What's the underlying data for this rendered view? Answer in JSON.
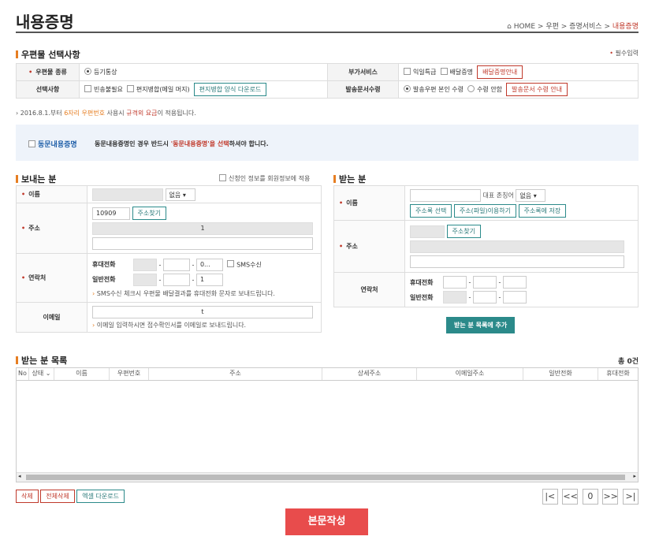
{
  "header": {
    "title": "내용증명",
    "breadcrumb": {
      "home": "HOME",
      "sep": ">",
      "c1": "우편",
      "c2": "증명서비스",
      "c3": "내용증명"
    }
  },
  "mail": {
    "section": "우편물 선택사항",
    "required": "필수입력",
    "type_label": "우편물 종류",
    "type_value": "등기통상",
    "extra_label": "부가서비스",
    "extra_opt1": "익일특급",
    "extra_opt2": "배달증명",
    "extra_btn": "배달증명안내",
    "select_label": "선택사항",
    "sel_opt1": "빈송불필요",
    "sel_opt2": "편지병합(메일 머지)",
    "sel_btn": "편지병합 양식 다운로드",
    "recv_label": "발송문서수령",
    "recv_opt1": "발송우편 본인 수령",
    "recv_opt2": "수령 안함",
    "recv_btn": "발송문서 수령 안내"
  },
  "notice": {
    "prefix": "› 2016.8.1.부터 ",
    "a": "6자리 우편번호",
    "b": " 사용시 ",
    "c": "규격외 요금",
    "d": "이 적용됩니다."
  },
  "same": {
    "label": "동문내용증명",
    "t1": "동문내용증명인 경우 반드시 ",
    "t2": "'동문내용증명'을 선택",
    "t3": "하셔야 합니다."
  },
  "sender": {
    "section": "보내는 분",
    "apply": "신청인 정보를 회원정보에 적용",
    "name_label": "이름",
    "title_sel": "없음",
    "addr_label": "주소",
    "zip": "10909",
    "zip_btn": "주소찾기",
    "addr_line": "1",
    "contact_label": "연락처",
    "mobile_label": "휴대전화",
    "m3": "0...",
    "sms": "SMS수신",
    "home_label": "일반전화",
    "h3": "1",
    "sms_note": "SMS수신 체크시 우편물 배달결과를 휴대전화 문자로 보내드립니다.",
    "email_label": "이메일",
    "email_val": "t",
    "email_note": "이메일 입력하시면 접수확인서를 이메일로 보내드립니다."
  },
  "receiver": {
    "section": "받는 분",
    "name_label": "이름",
    "title_label": "대표 존칭어",
    "title_sel": "없음",
    "btn1": "주소록 선택",
    "btn2": "주소(파일)이용하기",
    "btn3": "주소록에 저장",
    "addr_label": "주소",
    "zip_btn": "주소찾기",
    "contact_label": "연락처",
    "mobile_label": "휴대전화",
    "home_label": "일반전화",
    "add_btn": "받는 분 목록에 추가"
  },
  "list": {
    "section": "받는 분 목록",
    "count": "총 0건",
    "cols": [
      "No",
      "상태",
      "이름",
      "우편번호",
      "주소",
      "상세주소",
      "이메일주소",
      "일반전화",
      "휴대전화"
    ],
    "del": "삭제",
    "del_all": "전체삭제",
    "excel": "엑셀 다운로드",
    "pager": {
      "first": "|<",
      "prev": "<<",
      "page": "0",
      "next": ">>",
      "last": ">|"
    }
  },
  "submit": "본문작성"
}
